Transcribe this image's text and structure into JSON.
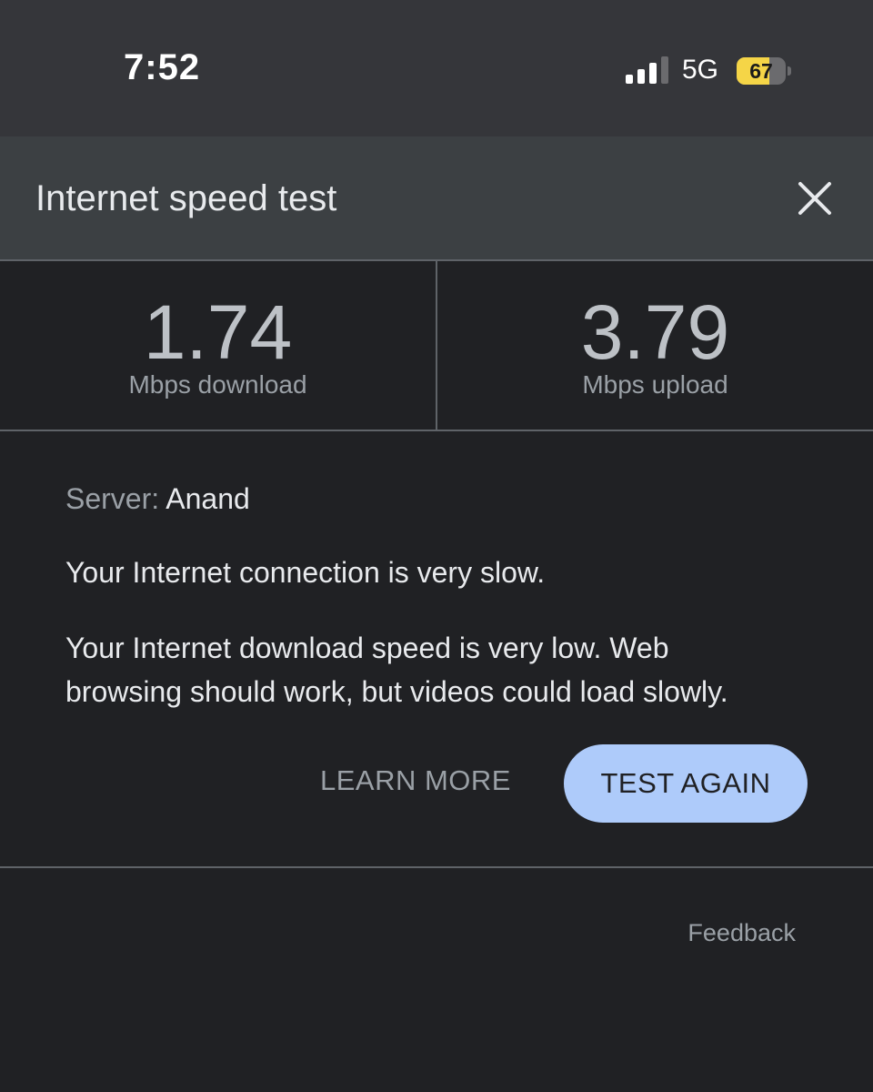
{
  "status_bar": {
    "time": "7:52",
    "network": "5G",
    "battery_level": "67",
    "signal_bars_active": 3,
    "signal_bars_total": 4,
    "signal_active_color": "#ffffff",
    "signal_inactive_color": "#6b6b6e",
    "battery_fill_color": "#f5d547"
  },
  "header": {
    "title": "Internet speed test",
    "close_icon": "close-icon"
  },
  "results": {
    "download": {
      "value": "1.74",
      "label": "Mbps download"
    },
    "upload": {
      "value": "3.79",
      "label": "Mbps upload"
    }
  },
  "details": {
    "server_label": "Server:",
    "server_name": "Anand",
    "summary": "Your Internet connection is very slow.",
    "description": "Your Internet download speed is very low. Web browsing should work, but videos could load slowly."
  },
  "actions": {
    "learn_more": "LEARN MORE",
    "test_again": "TEST AGAIN"
  },
  "footer": {
    "feedback": "Feedback"
  },
  "colors": {
    "background": "#202124",
    "header_background": "#3c4043",
    "primary_button": "#aecbfa",
    "divider": "#5f6368"
  }
}
